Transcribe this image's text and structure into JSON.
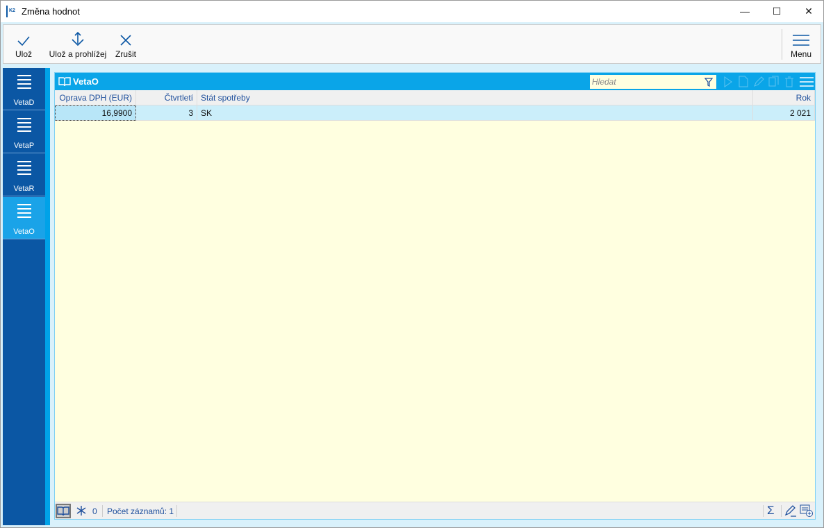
{
  "window": {
    "title": "Změna hodnot",
    "logo_text": "K2"
  },
  "toolbar": {
    "save": "Ulož",
    "save_view": "Ulož a prohlížej",
    "cancel": "Zrušit",
    "menu": "Menu"
  },
  "sidebar": {
    "items": [
      {
        "label": "VetaD"
      },
      {
        "label": "VetaP"
      },
      {
        "label": "VetaR"
      },
      {
        "label": "VetaO",
        "active": true
      }
    ]
  },
  "panel": {
    "title": "VetaO",
    "search_placeholder": "Hledat",
    "columns": [
      "Oprava DPH (EUR)",
      "Čtvrtletí",
      "Stát spotřeby",
      "Rok"
    ],
    "rows": [
      [
        "16,9900",
        "3",
        "SK",
        "2 021"
      ]
    ]
  },
  "status": {
    "frozen_count": "0",
    "record_count": "Počet záznamů: 1"
  },
  "colors": {
    "sidebar": "#0b57a4",
    "accent": "#0aa5e8",
    "active_item": "#1aa3e8",
    "grid_bg": "#ffffe0",
    "selected_row": "#cbeefa"
  }
}
